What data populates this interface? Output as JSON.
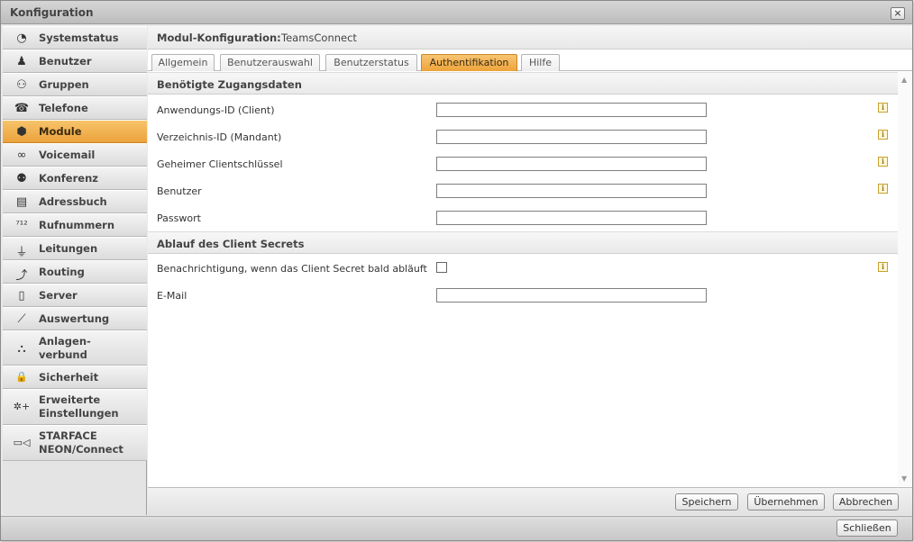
{
  "window": {
    "title": "Konfiguration",
    "close_symbol": "×"
  },
  "sidebar": {
    "items": [
      {
        "label": "Systemstatus",
        "icon": "pie-chart-icon",
        "glyph": "◔"
      },
      {
        "label": "Benutzer",
        "icon": "user-icon",
        "glyph": "♟"
      },
      {
        "label": "Gruppen",
        "icon": "group-icon",
        "glyph": "⚇"
      },
      {
        "label": "Telefone",
        "icon": "phone-icon",
        "glyph": "☎"
      },
      {
        "label": "Module",
        "icon": "cube-icon",
        "glyph": "⬢",
        "active": true
      },
      {
        "label": "Voicemail",
        "icon": "voicemail-icon",
        "glyph": "∞"
      },
      {
        "label": "Konferenz",
        "icon": "conference-icon",
        "glyph": "⚉"
      },
      {
        "label": "Adressbuch",
        "icon": "addressbook-icon",
        "glyph": "▤"
      },
      {
        "label": "Rufnummern",
        "icon": "numbers-icon",
        "glyph": "⁷¹²"
      },
      {
        "label": "Leitungen",
        "icon": "plug-icon",
        "glyph": "⏚"
      },
      {
        "label": "Routing",
        "icon": "routing-icon",
        "glyph": "⤴"
      },
      {
        "label": "Server",
        "icon": "server-icon",
        "glyph": "▯"
      },
      {
        "label": "Auswertung",
        "icon": "line-chart-icon",
        "glyph": "⟋"
      },
      {
        "label": "Anlagen-\nverbund",
        "icon": "network-icon",
        "glyph": "⛬"
      },
      {
        "label": "Sicherheit",
        "icon": "lock-icon",
        "glyph": "🔒"
      },
      {
        "label": "Erweiterte\nEinstellungen",
        "icon": "settings-plus-icon",
        "glyph": "✲+"
      },
      {
        "label": "STARFACE\nNEON/Connect",
        "icon": "video-icon",
        "glyph": "▭◁"
      }
    ]
  },
  "header": {
    "label": "Modul-Konfiguration:",
    "value": "TeamsConnect"
  },
  "tabs": [
    {
      "label": "Allgemein"
    },
    {
      "label": "Benutzerauswahl"
    },
    {
      "label": "Benutzerstatus"
    },
    {
      "label": "Authentifikation",
      "active": true
    },
    {
      "label": "Hilfe"
    }
  ],
  "sections": {
    "credentials": {
      "title": "Benötigte Zugangsdaten",
      "fields": [
        {
          "label": "Anwendungs-ID (Client)",
          "value": "",
          "info": true
        },
        {
          "label": "Verzeichnis-ID (Mandant)",
          "value": "",
          "info": true
        },
        {
          "label": "Geheimer Clientschlüssel",
          "value": "",
          "info": true
        },
        {
          "label": "Benutzer",
          "value": "",
          "info": true
        },
        {
          "label": "Passwort",
          "value": "",
          "info": false
        }
      ]
    },
    "expiry": {
      "title": "Ablauf des Client Secrets",
      "notify_label": "Benachrichtigung, wenn das Client Secret bald abläuft",
      "notify_checked": false,
      "email_label": "E-Mail",
      "email_value": ""
    }
  },
  "info_glyph": "i",
  "scroll": {
    "up": "▲",
    "down": "▼"
  },
  "footer": {
    "save": "Speichern",
    "apply": "Übernehmen",
    "cancel": "Abbrechen"
  },
  "bottom": {
    "close": "Schließen"
  },
  "colors": {
    "accent": "#eda33a",
    "accent_light": "#f8c572"
  }
}
